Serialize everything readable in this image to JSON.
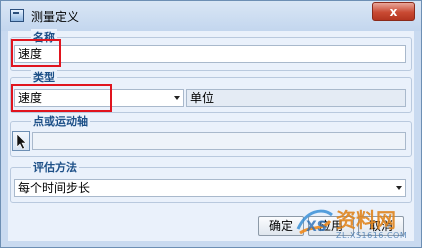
{
  "window": {
    "title": "测量定义",
    "close_label": "x"
  },
  "name_group": {
    "legend": "名称",
    "value": "速度"
  },
  "type_group": {
    "legend": "类型",
    "selected": "速度",
    "unit_label": "单位"
  },
  "axis_group": {
    "legend": "点或运动轴",
    "value": ""
  },
  "eval_group": {
    "legend": "评估方法",
    "selected": "每个时间步长"
  },
  "buttons": {
    "ok": "确定",
    "apply": "应用",
    "cancel": "取消"
  },
  "watermark": {
    "text": "资料网",
    "url": "ZL.XS1616.COM"
  },
  "colors": {
    "accent": "#1c4f87",
    "highlight": "#e0141e",
    "close": "#c94a33"
  }
}
